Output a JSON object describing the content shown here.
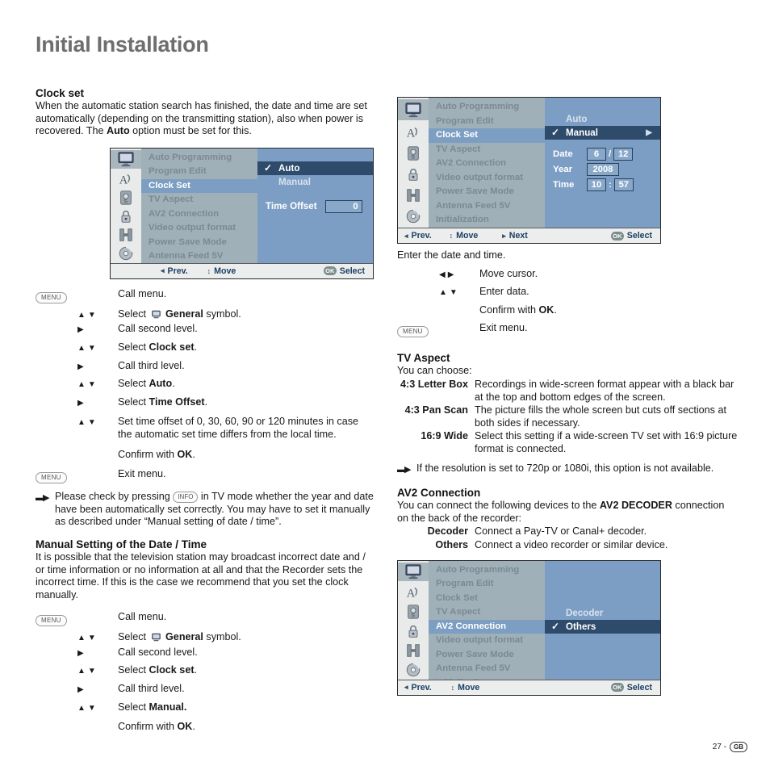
{
  "page": {
    "title": "Initial Installation",
    "page_number": "27 -",
    "region_code": "GB"
  },
  "osd_common": {
    "menu_items": [
      "Auto Programming",
      "Program Edit",
      "Clock Set",
      "TV Aspect",
      "AV2 Connection",
      "Video output format",
      "Power Save Mode",
      "Antenna Feed 5V",
      "Initialization"
    ],
    "icons": [
      "tv-icon",
      "language-icon",
      "recording-icon",
      "lock-icon",
      "disc-edit-icon",
      "disc-icon"
    ],
    "footer": {
      "prev": "Prev.",
      "move": "Move",
      "next": "Next",
      "select": "Select",
      "ok_badge": "OK"
    },
    "colors": {
      "panel_blue": "#7d9ec4",
      "list_gray": "#a0b0b8",
      "highlight_blue": "#7b9ec2",
      "selected_navy": "#2e4b6b",
      "footer_bg": "#eceeee",
      "title_gray": "#6e6e6e"
    }
  },
  "osd_clock_auto": {
    "active_item": "Clock Set",
    "options": [
      {
        "label": "Auto",
        "checked": true,
        "selected": true
      },
      {
        "label": "Manual",
        "checked": false,
        "selected": false
      }
    ],
    "time_offset_label": "Time Offset",
    "time_offset_value": "0"
  },
  "osd_clock_manual": {
    "active_item": "Clock Set",
    "options": [
      {
        "label": "Auto",
        "checked": false,
        "selected": false
      },
      {
        "label": "Manual",
        "checked": true,
        "selected": true
      }
    ],
    "fields": [
      {
        "label": "Date",
        "values": [
          "6",
          "12"
        ],
        "separator": "/"
      },
      {
        "label": "Year",
        "values": [
          "2008"
        ],
        "separator": ""
      },
      {
        "label": "Time",
        "values": [
          "10",
          "57"
        ],
        "separator": ":"
      }
    ]
  },
  "osd_av2": {
    "active_item": "AV2 Connection",
    "options": [
      {
        "label": "Decoder",
        "checked": false,
        "selected": false
      },
      {
        "label": "Others",
        "checked": true,
        "selected": true
      }
    ]
  },
  "clock_set": {
    "heading": "Clock set",
    "intro": "When the automatic station search has finished, the date and time are set automatically (depending on the transmitting station), also when power is recovered. The Auto option must be set for this.",
    "intro_bold": "Auto",
    "steps": [
      {
        "key": "MENU",
        "arrows": "",
        "text": "Call menu."
      },
      {
        "key": "",
        "arrows": "updown",
        "text": "Select  General symbol.",
        "bold": "General"
      },
      {
        "key": "",
        "arrows": "right",
        "text": "Call second level."
      },
      {
        "key": "",
        "arrows": "updown",
        "text": "Select Clock set.",
        "bold": "Clock set"
      },
      {
        "key": "",
        "arrows": "right",
        "text": "Call third level."
      },
      {
        "key": "",
        "arrows": "updown",
        "text": "Select Auto.",
        "bold": "Auto"
      },
      {
        "key": "",
        "arrows": "right",
        "text": "Select Time Offset.",
        "bold": "Time Offset"
      },
      {
        "key": "",
        "arrows": "updown",
        "text": "Set time offset of 0, 30, 60, 90 or 120 minutes in case the automatic set time differs from the local time."
      },
      {
        "key": "",
        "arrows": "",
        "text": "Confirm with OK.",
        "bold": "OK"
      },
      {
        "key": "MENU",
        "arrows": "",
        "text": "Exit menu."
      }
    ],
    "note": "Please check by pressing INFO in TV mode whether the year and date have been automatically set correctly. You may have to set it manually as described under “Manual setting of date / time”.",
    "note_key": "INFO"
  },
  "manual_setting": {
    "heading": "Manual Setting of the Date / Time",
    "intro": "It is possible that the television station may broadcast incorrect date and / or time information or no information at all and that the Recorder sets the incorrect time. If this is the case we recommend that you set the clock manually.",
    "steps": [
      {
        "key": "MENU",
        "arrows": "",
        "text": "Call menu."
      },
      {
        "key": "",
        "arrows": "updown",
        "text": "Select  General symbol.",
        "bold": "General"
      },
      {
        "key": "",
        "arrows": "right",
        "text": "Call second level."
      },
      {
        "key": "",
        "arrows": "updown",
        "text": "Select Clock set.",
        "bold": "Clock set"
      },
      {
        "key": "",
        "arrows": "right",
        "text": "Call third level."
      },
      {
        "key": "",
        "arrows": "updown",
        "text": "Select Manual.",
        "bold": "Manual."
      },
      {
        "key": "",
        "arrows": "",
        "text": "Confirm with OK.",
        "bold": "OK"
      }
    ]
  },
  "right_steps": {
    "lead": "Enter the date and time.",
    "steps": [
      {
        "key": "",
        "arrows": "leftright",
        "text": "Move cursor."
      },
      {
        "key": "",
        "arrows": "updown",
        "text": "Enter data."
      },
      {
        "key": "",
        "arrows": "",
        "text": "Confirm with OK.",
        "bold": "OK"
      },
      {
        "key": "MENU",
        "arrows": "",
        "text": "Exit menu."
      }
    ]
  },
  "tv_aspect": {
    "heading": "TV Aspect",
    "intro": "You can choose:",
    "rows": [
      {
        "term": "4:3 Letter Box",
        "desc": "Recordings in wide-screen format appear with a black bar at the top and bottom edges of the screen."
      },
      {
        "term": "4:3 Pan Scan",
        "desc": "The picture fills the whole screen but cuts off sections at both sides if necessary."
      },
      {
        "term": "16:9 Wide",
        "desc": "Select this setting if a wide-screen TV set with 16:9 picture format is connected."
      }
    ],
    "note": "If the resolution is set to 720p or 1080i, this option is not available."
  },
  "av2_connection": {
    "heading": "AV2 Connection",
    "intro_pre": "You can connect the following devices to the ",
    "intro_bold": "AV2 DECODER",
    "intro_post": " connection on the back of the recorder:",
    "rows": [
      {
        "term": "Decoder",
        "desc": "Connect a Pay-TV or Canal+ decoder."
      },
      {
        "term": "Others",
        "desc": "Connect a video recorder or similar device."
      }
    ]
  }
}
